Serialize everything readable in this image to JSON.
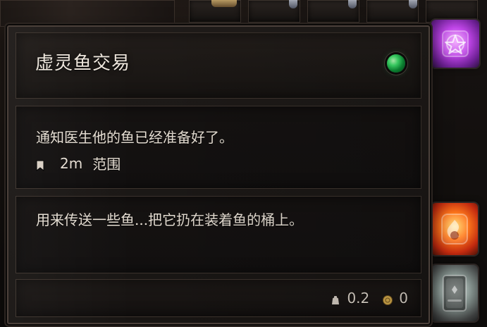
{
  "tooltip": {
    "title": "虚灵鱼交易",
    "status_color": "#2fd15f",
    "objective": "通知医生他的鱼已经准备好了。",
    "range": {
      "icon": "bookmark-icon",
      "value": "2m",
      "label": "范围"
    },
    "description": "用来传送一些鱼...把它扔在装着鱼的桶上。",
    "footer": {
      "weight": {
        "icon": "weight-icon",
        "value": "0.2"
      },
      "value": {
        "icon": "coin-icon",
        "value": "0"
      }
    }
  },
  "side_items": [
    {
      "icon": "pentagram-scroll-icon",
      "color": "#c046e8"
    },
    {
      "icon": "fire-scroll-icon",
      "color": "#ff7a1c"
    },
    {
      "icon": "spellbook-icon",
      "color": "#7e8b87"
    }
  ]
}
